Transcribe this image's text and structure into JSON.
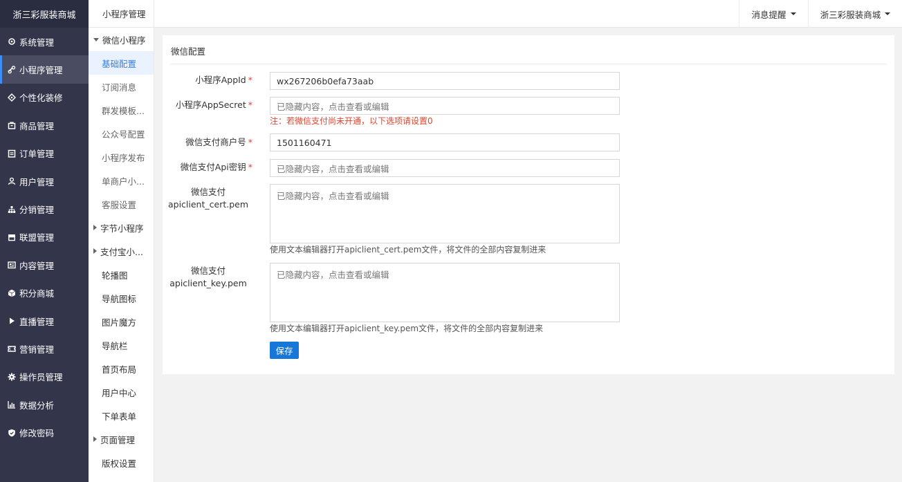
{
  "brand": "浙三彩服装商城",
  "main_nav": [
    {
      "label": "系统管理",
      "icon": "gear-outline-icon"
    },
    {
      "label": "小程序管理",
      "icon": "link-icon"
    },
    {
      "label": "个性化装修",
      "icon": "palette-icon"
    },
    {
      "label": "商品管理",
      "icon": "bag-icon"
    },
    {
      "label": "订单管理",
      "icon": "clipboard-icon"
    },
    {
      "label": "用户管理",
      "icon": "user-icon"
    },
    {
      "label": "分销管理",
      "icon": "network-icon"
    },
    {
      "label": "联盟管理",
      "icon": "store-icon"
    },
    {
      "label": "内容管理",
      "icon": "article-icon"
    },
    {
      "label": "积分商城",
      "icon": "cube-icon"
    },
    {
      "label": "直播管理",
      "icon": "play-icon"
    },
    {
      "label": "营销管理",
      "icon": "ticket-icon"
    },
    {
      "label": "操作员管理",
      "icon": "gear-icon"
    },
    {
      "label": "数据分析",
      "icon": "bar-chart-icon"
    },
    {
      "label": "修改密码",
      "icon": "shield-icon"
    }
  ],
  "subnav": {
    "header": "小程序管理",
    "items": [
      {
        "label": "微信小程序",
        "type": "group",
        "expanded": true
      },
      {
        "label": "基础配置",
        "type": "item",
        "active": true
      },
      {
        "label": "订阅消息",
        "type": "item"
      },
      {
        "label": "群发模板...",
        "type": "item"
      },
      {
        "label": "公众号配置",
        "type": "item"
      },
      {
        "label": "小程序发布",
        "type": "item"
      },
      {
        "label": "单商户小...",
        "type": "item"
      },
      {
        "label": "客服设置",
        "type": "item"
      },
      {
        "label": "字节小程序",
        "type": "group",
        "expanded": false
      },
      {
        "label": "支付宝小...",
        "type": "group",
        "expanded": false
      },
      {
        "label": "轮播图",
        "type": "item",
        "dark": true
      },
      {
        "label": "导航图标",
        "type": "item",
        "dark": true
      },
      {
        "label": "图片魔方",
        "type": "item",
        "dark": true
      },
      {
        "label": "导航栏",
        "type": "item",
        "dark": true
      },
      {
        "label": "首页布局",
        "type": "item",
        "dark": true
      },
      {
        "label": "用户中心",
        "type": "item",
        "dark": true
      },
      {
        "label": "下单表单",
        "type": "item",
        "dark": true
      },
      {
        "label": "页面管理",
        "type": "group",
        "expanded": false
      },
      {
        "label": "版权设置",
        "type": "item",
        "dark": true
      }
    ]
  },
  "topbar": {
    "notifications": "消息提醒",
    "account": "浙三彩服装商城"
  },
  "form": {
    "title": "微信配置",
    "appid": {
      "label": "小程序AppId",
      "value": "wx267206b0efa73aab"
    },
    "appsecret": {
      "label": "小程序AppSecret",
      "placeholder": "已隐藏内容，点击查看或编辑"
    },
    "notice": "注：若微信支付尚未开通，以下选项请设置0",
    "mch_id": {
      "label": "微信支付商户号",
      "value": "1501160471"
    },
    "api_key": {
      "label": "微信支付Api密钥",
      "placeholder": "已隐藏内容，点击查看或编辑"
    },
    "cert": {
      "label_line1": "微信支付",
      "label_line2": "apiclient_cert.pem",
      "placeholder": "已隐藏内容，点击查看或编辑",
      "hint": "使用文本编辑器打开apiclient_cert.pem文件，将文件的全部内容复制进来"
    },
    "key": {
      "label_line1": "微信支付",
      "label_line2": "apiclient_key.pem",
      "placeholder": "已隐藏内容，点击查看或编辑",
      "hint": "使用文本编辑器打开apiclient_key.pem文件，将文件的全部内容复制进来"
    },
    "save_label": "保存"
  },
  "colors": {
    "sidebar": "#33354a",
    "accent": "#1677d9",
    "required": "#e33",
    "warning": "#e0442f"
  }
}
